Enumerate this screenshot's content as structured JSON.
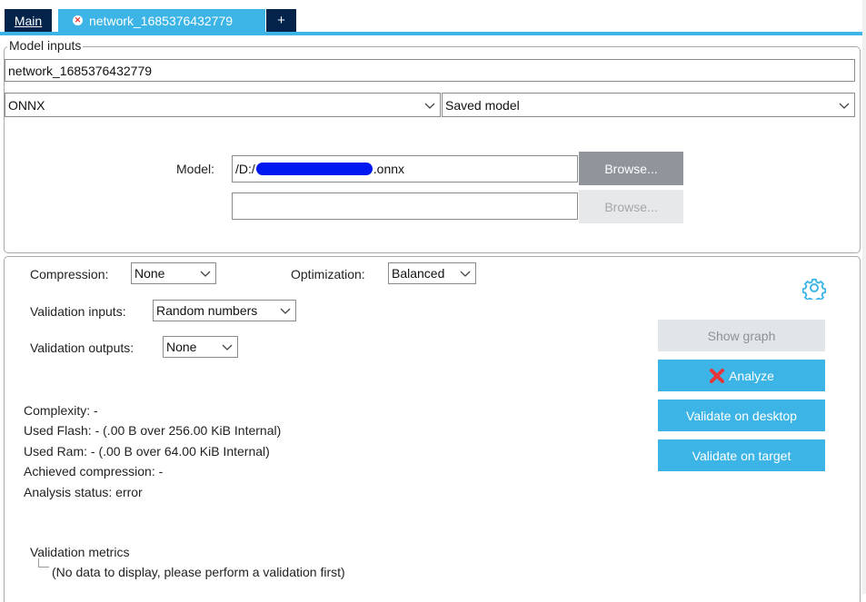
{
  "tabs": {
    "main": "Main",
    "network": "network_1685376432779",
    "add": "+"
  },
  "model_inputs": {
    "legend": "Model inputs",
    "name_value": "network_1685376432779",
    "framework": "ONNX",
    "model_type": "Saved model",
    "model_label": "Model:",
    "model_path_prefix": "/D:/",
    "model_path_suffix": ".onnx",
    "second_path": "",
    "browse_1": "Browse...",
    "browse_2": "Browse..."
  },
  "settings": {
    "compression_label": "Compression:",
    "compression_value": "None",
    "optimization_label": "Optimization:",
    "optimization_value": "Balanced",
    "validation_inputs_label": "Validation inputs:",
    "validation_inputs_value": "Random numbers",
    "validation_outputs_label": "Validation outputs:",
    "validation_outputs_value": "None"
  },
  "actions": {
    "show_graph": "Show graph",
    "analyze": "Analyze",
    "validate_desktop": "Validate on desktop",
    "validate_target": "Validate on target"
  },
  "results": {
    "complexity": "Complexity: -",
    "used_flash": "Used Flash: - (.00 B over 256.00 KiB Internal)",
    "used_ram": "Used Ram: - (.00 B over 64.00 KiB Internal)",
    "achieved_compression": "Achieved compression: -",
    "analysis_status": "Analysis status: error"
  },
  "validation_metrics": {
    "title": "Validation metrics",
    "empty_message": "(No data to display, please perform a validation first)"
  },
  "colors": {
    "accent": "#3cb4e6",
    "navy": "#03234b",
    "error": "#e8353a",
    "redaction": "#0018f0"
  },
  "icons": {
    "tab_close": "close-circle-icon",
    "settings": "gear-icon",
    "analyze": "red-x-icon",
    "dropdown": "chevron-down-icon"
  }
}
